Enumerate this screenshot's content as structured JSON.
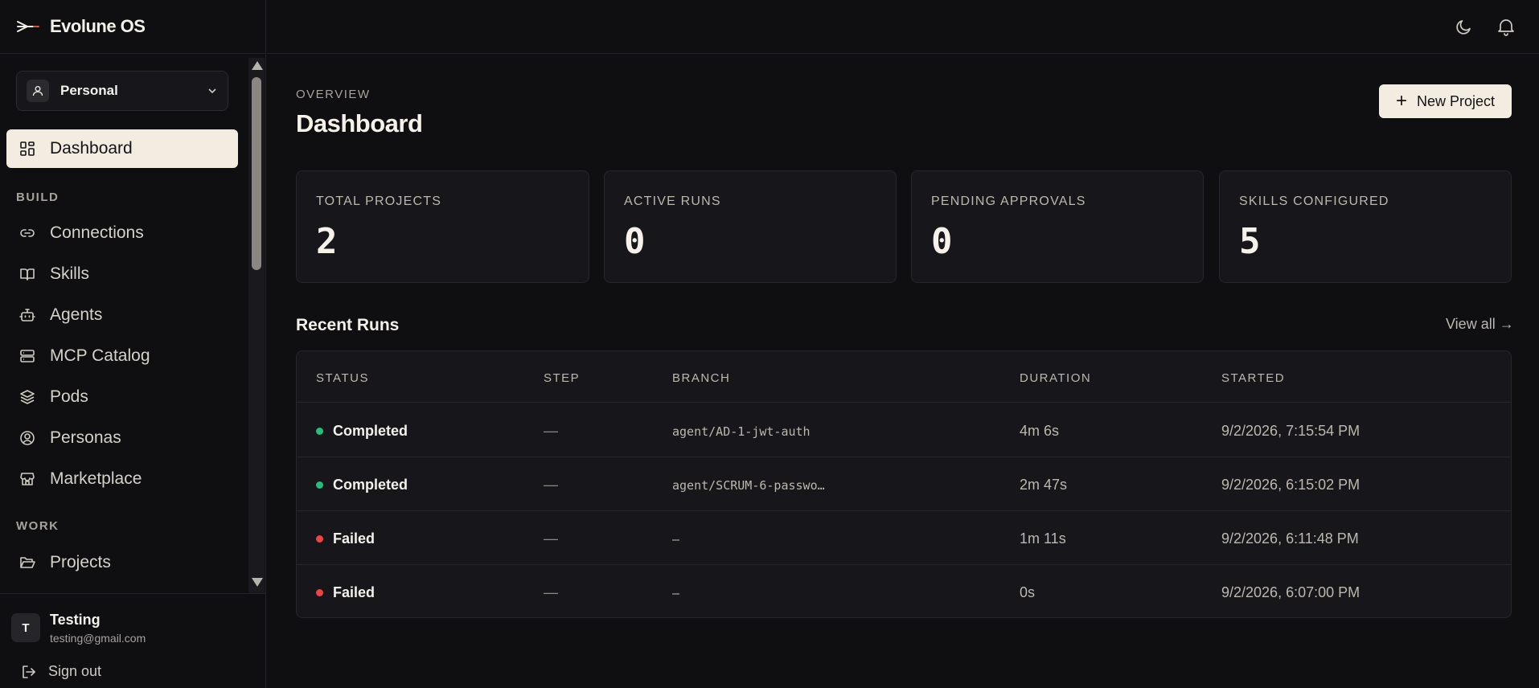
{
  "brand": {
    "name": "Evolune OS"
  },
  "workspace": {
    "label": "Personal"
  },
  "sidebar": {
    "items": [
      {
        "label": "Dashboard"
      },
      {
        "label": "Connections"
      },
      {
        "label": "Skills"
      },
      {
        "label": "Agents"
      },
      {
        "label": "MCP Catalog"
      },
      {
        "label": "Pods"
      },
      {
        "label": "Personas"
      },
      {
        "label": "Marketplace"
      },
      {
        "label": "Projects"
      }
    ],
    "sections": {
      "build": "BUILD",
      "work": "WORK"
    }
  },
  "user": {
    "initial": "T",
    "name": "Testing",
    "email": "testing@gmail.com",
    "signout_label": "Sign out"
  },
  "header": {
    "eyebrow": "OVERVIEW",
    "title": "Dashboard",
    "new_project_label": "New Project"
  },
  "stats": [
    {
      "label": "TOTAL PROJECTS",
      "value": "2"
    },
    {
      "label": "ACTIVE RUNS",
      "value": "0"
    },
    {
      "label": "PENDING APPROVALS",
      "value": "0"
    },
    {
      "label": "SKILLS CONFIGURED",
      "value": "5"
    }
  ],
  "recent_runs": {
    "title": "Recent Runs",
    "view_all_label": "View all →",
    "columns": [
      "STATUS",
      "STEP",
      "BRANCH",
      "DURATION",
      "STARTED"
    ],
    "rows": [
      {
        "status": "Completed",
        "status_color": "#22c07a",
        "step": "—",
        "branch": "agent/AD-1-jwt-auth",
        "duration": "4m 6s",
        "started": "9/2/2026, 7:15:54 PM"
      },
      {
        "status": "Completed",
        "status_color": "#22c07a",
        "step": "—",
        "branch": "agent/SCRUM-6-passwo…",
        "duration": "2m 47s",
        "started": "9/2/2026, 6:15:02 PM"
      },
      {
        "status": "Failed",
        "status_color": "#ef4444",
        "step": "—",
        "branch": "–",
        "duration": "1m 11s",
        "started": "9/2/2026, 6:11:48 PM"
      },
      {
        "status": "Failed",
        "status_color": "#ef4444",
        "step": "—",
        "branch": "–",
        "duration": "0s",
        "started": "9/2/2026, 6:07:00 PM"
      }
    ]
  },
  "colors": {
    "accent_bg": "#f3ede1",
    "completed": "#22c07a",
    "failed": "#ef4444"
  }
}
